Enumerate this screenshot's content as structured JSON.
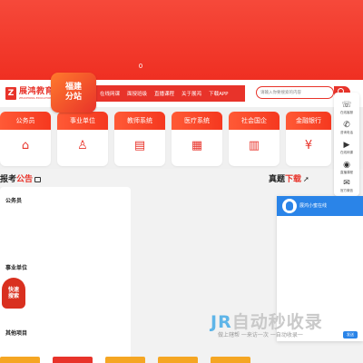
{
  "banner": {
    "indicator": "0"
  },
  "logo": {
    "cn": "展鸿教育",
    "en": "ZHANHONG EDUCATION",
    "mark": "Z"
  },
  "branch": {
    "line1": "福建",
    "line2": "分站"
  },
  "nav": [
    "在线网课",
    "面授班级",
    "直播课程",
    "关于展鸿",
    "下载APP"
  ],
  "search": {
    "placeholder": "请输入你要搜索的内容"
  },
  "categories": [
    {
      "label": "公务员",
      "icon": "building-icon",
      "glyph": "⌂"
    },
    {
      "label": "事业单位",
      "icon": "chair-icon",
      "glyph": "♙"
    },
    {
      "label": "教师系统",
      "icon": "book-icon",
      "glyph": "▤"
    },
    {
      "label": "医疗系统",
      "icon": "hospital-icon",
      "glyph": "▦"
    },
    {
      "label": "社会国企",
      "icon": "office-icon",
      "glyph": "▥"
    },
    {
      "label": "金融银行",
      "icon": "bank-icon",
      "glyph": "¥"
    }
  ],
  "side_toolbar": [
    {
      "label": "在线客服",
      "icon": "headset-icon",
      "glyph": "☏"
    },
    {
      "label": "咨询电话",
      "icon": "phone-icon",
      "glyph": "✆"
    },
    {
      "label": "在线网课",
      "icon": "play-icon",
      "glyph": "▶"
    },
    {
      "label": "直播课程",
      "icon": "live-icon",
      "glyph": "◉"
    },
    {
      "label": "官方微信",
      "icon": "wechat-icon",
      "glyph": "✉"
    }
  ],
  "sections": {
    "announce": {
      "pre": "报考",
      "hl": "公告"
    },
    "exam": {
      "pre": "真题",
      "hl": "下载"
    }
  },
  "panel": {
    "cat1": "公务员",
    "cat2": "事业单位",
    "cat3": "其他项目",
    "quick_line1": "快速",
    "quick_line2": "搜索"
  },
  "chat": {
    "name": "展鸿小蜜在线",
    "send": "发送"
  },
  "watermark": {
    "jr": "JR",
    "main": "自动秒收录",
    "sub": "做上辖帮 一来访一次 一自动收录一"
  },
  "colors": {
    "primary": "#e8332a",
    "chat_blue": "#2a84e8"
  }
}
